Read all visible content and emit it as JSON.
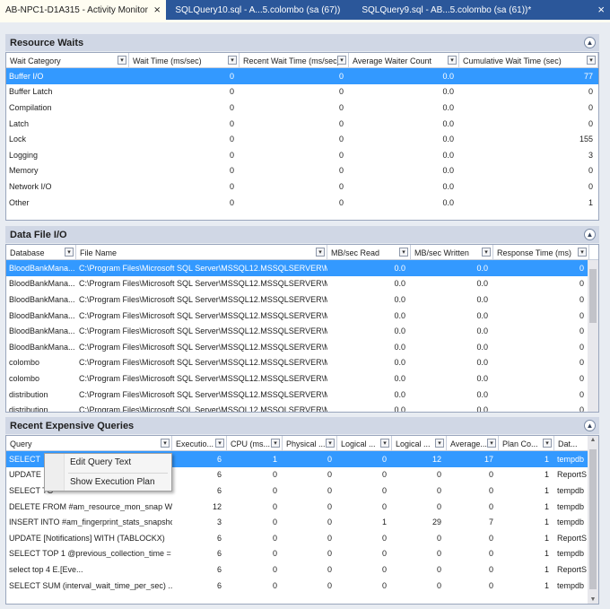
{
  "tabs": [
    {
      "label": "AB-NPC1-D1A315 - Activity Monitor",
      "active": true,
      "close": "⨯"
    },
    {
      "label": "SQLQuery10.sql - A...5.colombo (sa (67))",
      "active": false
    },
    {
      "label": "SQLQuery9.sql - AB...5.colombo (sa (61))*",
      "active": false
    }
  ],
  "tab_overflow": "×",
  "resource_waits": {
    "title": "Resource Waits",
    "columns": [
      "Wait Category",
      "Wait Time (ms/sec)",
      "Recent Wait Time (ms/sec)",
      "Average Waiter Count",
      "Cumulative Wait Time (sec)"
    ],
    "rows": [
      [
        "Buffer I/O",
        "0",
        "0",
        "0.0",
        "77"
      ],
      [
        "Buffer Latch",
        "0",
        "0",
        "0.0",
        "0"
      ],
      [
        "Compilation",
        "0",
        "0",
        "0.0",
        "0"
      ],
      [
        "Latch",
        "0",
        "0",
        "0.0",
        "0"
      ],
      [
        "Lock",
        "0",
        "0",
        "0.0",
        "155"
      ],
      [
        "Logging",
        "0",
        "0",
        "0.0",
        "3"
      ],
      [
        "Memory",
        "0",
        "0",
        "0.0",
        "0"
      ],
      [
        "Network I/O",
        "0",
        "0",
        "0.0",
        "0"
      ],
      [
        "Other",
        "0",
        "0",
        "0.0",
        "1"
      ]
    ]
  },
  "data_file_io": {
    "title": "Data File I/O",
    "columns": [
      "Database",
      "File Name",
      "MB/sec Read",
      "MB/sec Written",
      "Response Time (ms)"
    ],
    "rows": [
      [
        "BloodBankMana...",
        "C:\\Program Files\\Microsoft SQL Server\\MSSQL12.MSSQLSERVER\\MS...",
        "0.0",
        "0.0",
        "0"
      ],
      [
        "BloodBankMana...",
        "C:\\Program Files\\Microsoft SQL Server\\MSSQL12.MSSQLSERVER\\MS...",
        "0.0",
        "0.0",
        "0"
      ],
      [
        "BloodBankMana...",
        "C:\\Program Files\\Microsoft SQL Server\\MSSQL12.MSSQLSERVER\\MS...",
        "0.0",
        "0.0",
        "0"
      ],
      [
        "BloodBankMana...",
        "C:\\Program Files\\Microsoft SQL Server\\MSSQL12.MSSQLSERVER\\MS...",
        "0.0",
        "0.0",
        "0"
      ],
      [
        "BloodBankMana...",
        "C:\\Program Files\\Microsoft SQL Server\\MSSQL12.MSSQLSERVER\\MS...",
        "0.0",
        "0.0",
        "0"
      ],
      [
        "BloodBankMana...",
        "C:\\Program Files\\Microsoft SQL Server\\MSSQL12.MSSQLSERVER\\MS...",
        "0.0",
        "0.0",
        "0"
      ],
      [
        "colombo",
        "C:\\Program Files\\Microsoft SQL Server\\MSSQL12.MSSQLSERVER\\MS...",
        "0.0",
        "0.0",
        "0"
      ],
      [
        "colombo",
        "C:\\Program Files\\Microsoft SQL Server\\MSSQL12.MSSQLSERVER\\MS...",
        "0.0",
        "0.0",
        "0"
      ],
      [
        "distribution",
        "C:\\Program Files\\Microsoft SQL Server\\MSSQL12.MSSQLSERVER\\MS...",
        "0.0",
        "0.0",
        "0"
      ],
      [
        "distribution",
        "C:\\Program Files\\Microsoft SQL Server\\MSSQL12.MSSQLSERVER\\MS...",
        "0.0",
        "0.0",
        "0"
      ]
    ]
  },
  "expensive_queries": {
    "title": "Recent Expensive Queries",
    "columns": [
      "Query",
      "Executio...",
      "CPU (ms...",
      "Physical ...",
      "Logical ...",
      "Logical ...",
      "Average...",
      "Plan Co...",
      "Dat..."
    ],
    "rows": [
      [
        "SELECT",
        "6",
        "1",
        "0",
        "0",
        "12",
        "17",
        "1",
        "tempdb"
      ],
      [
        "UPDATE [",
        "6",
        "0",
        "0",
        "0",
        "0",
        "0",
        "1",
        "ReportS"
      ],
      [
        "SELECT TO",
        "6",
        "0",
        "0",
        "0",
        "0",
        "0",
        "1",
        "tempdb"
      ],
      [
        "DELETE FROM #am_resource_mon_snap WH...",
        "12",
        "0",
        "0",
        "0",
        "0",
        "0",
        "1",
        "tempdb"
      ],
      [
        "INSERT INTO #am_fingerprint_stats_snapshot...",
        "3",
        "0",
        "0",
        "1",
        "29",
        "7",
        "1",
        "tempdb"
      ],
      [
        "UPDATE [Notifications] WITH (TABLOCKX)",
        "6",
        "0",
        "0",
        "0",
        "0",
        "0",
        "1",
        "ReportS"
      ],
      [
        "SELECT TOP 1 @previous_collection_time = c...",
        "6",
        "0",
        "0",
        "0",
        "0",
        "0",
        "1",
        "tempdb"
      ],
      [
        "select top 4                                   E.[Eve...",
        "6",
        "0",
        "0",
        "0",
        "0",
        "0",
        "1",
        "ReportS"
      ],
      [
        "SELECT      SUM (interval_wait_time_per_sec) ...",
        "6",
        "0",
        "0",
        "0",
        "0",
        "0",
        "1",
        "tempdb"
      ]
    ]
  },
  "context_menu": {
    "items": [
      "Edit Query Text",
      "Show Execution Plan"
    ]
  },
  "colors": {
    "tab_bar": "#2b579a",
    "selection": "#3399ff",
    "panel_header": "#d0d7e5"
  }
}
